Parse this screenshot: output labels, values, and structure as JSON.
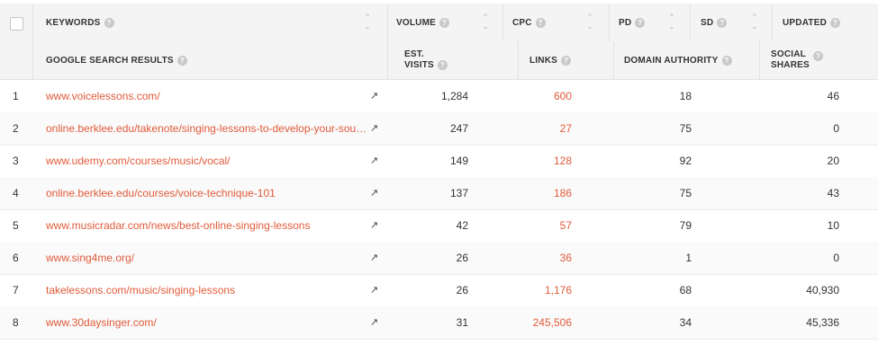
{
  "header_top": {
    "keywords": "KEYWORDS",
    "volume": "VOLUME",
    "cpc": "CPC",
    "pd": "PD",
    "sd": "SD",
    "updated": "UPDATED"
  },
  "header_sub": {
    "google": "GOOGLE SEARCH RESULTS",
    "est_visits_1": "EST.",
    "est_visits_2": "VISITS",
    "links": "LINKS",
    "domain_authority": "DOMAIN AUTHORITY",
    "social_1": "SOCIAL",
    "social_2": "SHARES"
  },
  "help_glyph": "?",
  "rows": [
    {
      "n": "1",
      "url": "www.voicelessons.com/",
      "visits": "1,284",
      "links": "600",
      "da": "18",
      "ss": "46"
    },
    {
      "n": "2",
      "url": "online.berklee.edu/takenote/singing-lessons-to-develop-your-soun...",
      "visits": "247",
      "links": "27",
      "da": "75",
      "ss": "0"
    },
    {
      "n": "3",
      "url": "www.udemy.com/courses/music/vocal/",
      "visits": "149",
      "links": "128",
      "da": "92",
      "ss": "20"
    },
    {
      "n": "4",
      "url": "online.berklee.edu/courses/voice-technique-101",
      "visits": "137",
      "links": "186",
      "da": "75",
      "ss": "43"
    },
    {
      "n": "5",
      "url": "www.musicradar.com/news/best-online-singing-lessons",
      "visits": "42",
      "links": "57",
      "da": "79",
      "ss": "10"
    },
    {
      "n": "6",
      "url": "www.sing4me.org/",
      "visits": "26",
      "links": "36",
      "da": "1",
      "ss": "0"
    },
    {
      "n": "7",
      "url": "takelessons.com/music/singing-lessons",
      "visits": "26",
      "links": "1,176",
      "da": "68",
      "ss": "40,930"
    },
    {
      "n": "8",
      "url": "www.30daysinger.com/",
      "visits": "31",
      "links": "245,506",
      "da": "34",
      "ss": "45,336"
    }
  ],
  "colors": {
    "link": "#e05b3a",
    "header_bg": "#f4f4f4"
  }
}
